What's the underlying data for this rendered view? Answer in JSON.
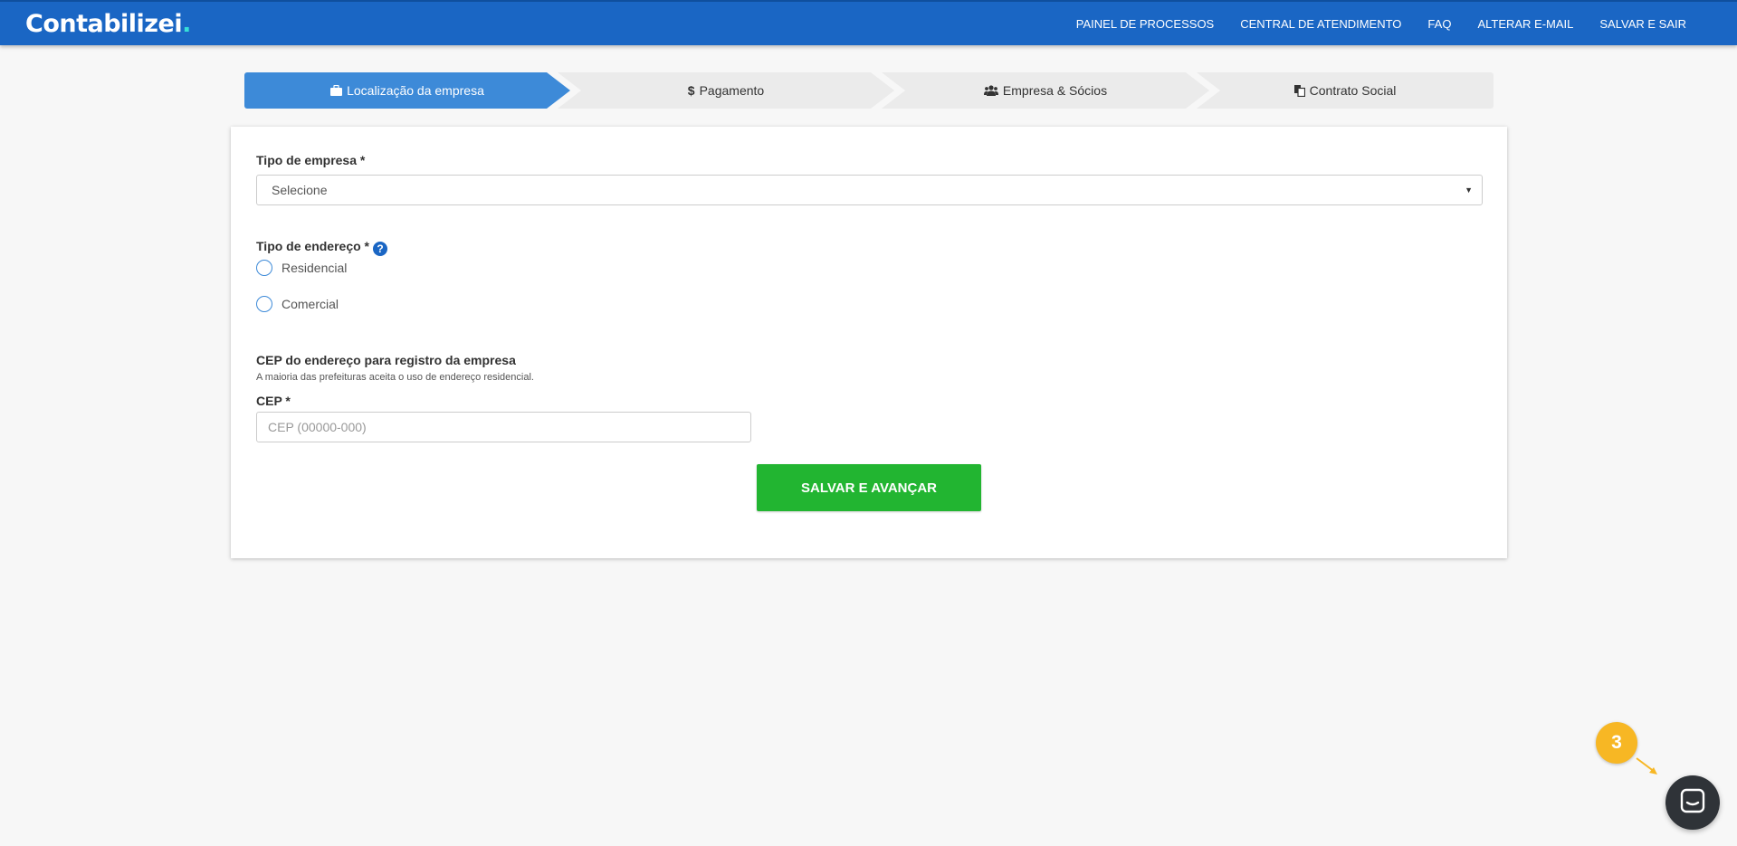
{
  "brand": {
    "name": "Contabilizei",
    "dot": ".",
    "dot_color": "#36e0d8"
  },
  "nav": {
    "items": [
      "PAINEL DE PROCESSOS",
      "CENTRAL DE ATENDIMENTO",
      "FAQ",
      "ALTERAR E-MAIL",
      "SALVAR E SAIR"
    ]
  },
  "steps": [
    {
      "label": "Localização da empresa",
      "icon": "briefcase-icon",
      "active": true
    },
    {
      "label": "Pagamento",
      "icon": "dollar-icon",
      "active": false
    },
    {
      "label": "Empresa & Sócios",
      "icon": "users-icon",
      "active": false
    },
    {
      "label": "Contrato Social",
      "icon": "documents-icon",
      "active": false
    }
  ],
  "form": {
    "company_type": {
      "label": "Tipo de empresa *",
      "selected": "Selecione"
    },
    "address_type": {
      "label": "Tipo de endereço *",
      "options": [
        "Residencial",
        "Comercial"
      ]
    },
    "cep_section": {
      "title": "CEP do endereço para registro da empresa",
      "hint": "A maioria das prefeituras aceita o uso de endereço residencial.",
      "label": "CEP *",
      "placeholder": "CEP (00000-000)",
      "value": ""
    },
    "submit_label": "SALVAR E AVANÇAR"
  },
  "chat": {
    "notification_count": "3"
  },
  "colors": {
    "navbar": "#1a66c4",
    "active_step": "#3d8ad8",
    "inactive_step": "#ebebeb",
    "submit": "#22b531",
    "badge": "#f7b724",
    "chat": "#2f3338"
  }
}
